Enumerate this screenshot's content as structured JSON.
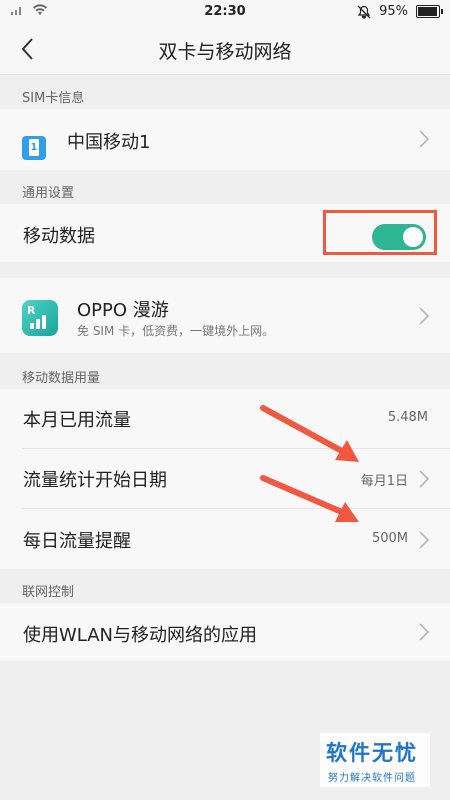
{
  "status": {
    "time": "22:30",
    "battery": "95%",
    "icons": [
      "signal-icon",
      "wifi-icon",
      "mute-icon",
      "battery-icon"
    ]
  },
  "navbar": {
    "title": "双卡与移动网络"
  },
  "sections": {
    "sim_info": "SIM卡信息",
    "general": "通用设置",
    "usage": "移动数据用量",
    "network_control": "联网控制"
  },
  "sim": {
    "label": "中国移动1",
    "icon_text": "1"
  },
  "mobile_data": {
    "label": "移动数据",
    "enabled": true
  },
  "roaming": {
    "title": "OPPO 漫游",
    "subtitle": "免 SIM 卡，低资费，一键境外上网。"
  },
  "usage": {
    "this_month_label": "本月已用流量",
    "this_month_value": "5.48M",
    "start_date_label": "流量统计开始日期",
    "start_date_value": "每月1日",
    "daily_alert_label": "每日流量提醒",
    "daily_alert_value": "500M"
  },
  "network_control": {
    "apps_label": "使用WLAN与移动网络的应用"
  },
  "watermark": {
    "big": "软件无忧",
    "small": "努力解决软件问题"
  },
  "colors": {
    "accent": "#2eb593",
    "annotation": "#f2573f",
    "watermark": "#1f75c8"
  }
}
